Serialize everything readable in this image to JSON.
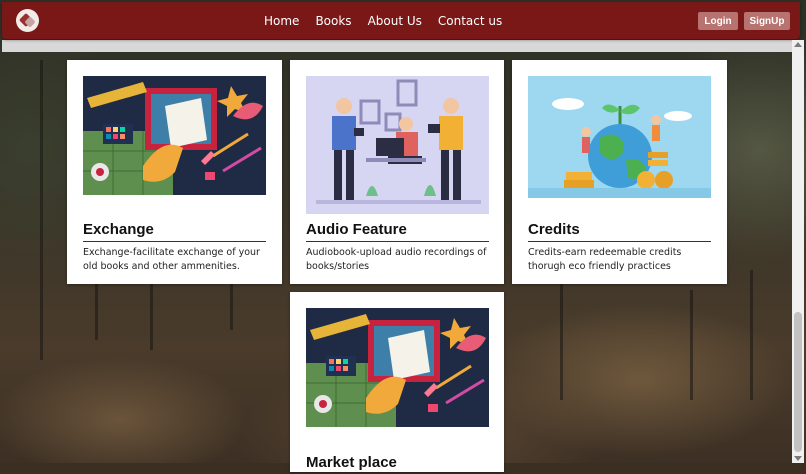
{
  "nav": {
    "links": [
      "Home",
      "Books",
      "About Us",
      "Contact us"
    ],
    "login_label": "Login",
    "signup_label": "SignUp"
  },
  "cards": [
    {
      "title": "Exchange",
      "description": "Exchange-facilitate exchange of your old books and other ammenities.",
      "illustration": "art-supplies-illustration"
    },
    {
      "title": "Audio Feature",
      "description": "Audiobook-upload audio recordings of books/stories",
      "illustration": "audio-recording-illustration"
    },
    {
      "title": "Credits",
      "description": "Credits-earn redeemable credits thorugh eco friendly practices",
      "illustration": "eco-credits-illustration"
    },
    {
      "title": "Market place",
      "description": "",
      "illustration": "art-supplies-illustration"
    }
  ],
  "colors": {
    "navbar": "#7a1717",
    "auth_button": "#b7736f",
    "card": "#ffffff"
  }
}
